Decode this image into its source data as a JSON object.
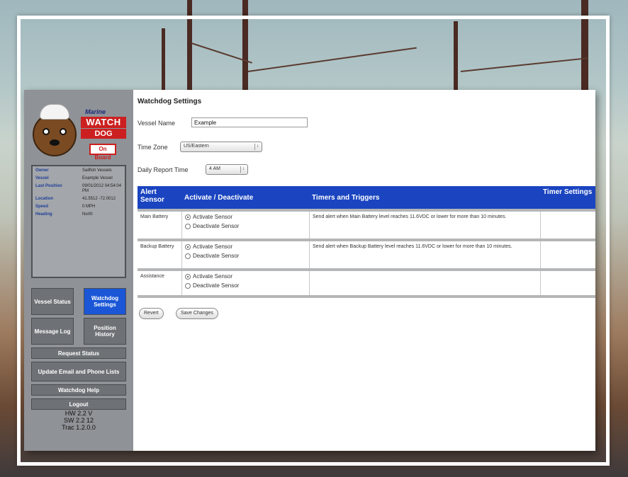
{
  "sidebar": {
    "logo": {
      "top_text": "Marine",
      "watch_text": "WATCH",
      "dog_text": "DOG",
      "onboard_text": "On Board"
    },
    "status": [
      {
        "key": "Owner",
        "value": "Sailfish Vessels"
      },
      {
        "key": "Vessel",
        "value": "Example Vessel"
      },
      {
        "key": "Last Position",
        "value": "09/01/2012 04:54:04 PM"
      },
      {
        "key": "Location",
        "value": "41.5512 -72.0012"
      },
      {
        "key": "Speed",
        "value": "0 MPH"
      },
      {
        "key": "Heading",
        "value": "North"
      }
    ],
    "nav": {
      "vessel_status": "Vessel Status",
      "watchdog_settings": "Watchdog Settings",
      "message_log": "Message Log",
      "position_history": "Position History",
      "request_status": "Request Status",
      "update_email": "Update Email and Phone Lists",
      "watchdog_help": "Watchdog Help",
      "logout": "Logout"
    },
    "versions": {
      "hw": "HW 2.2 V",
      "sw": "SW 2.2 12",
      "tracker": "Trac 1.2.0.0"
    }
  },
  "content": {
    "title": "Watchdog Settings",
    "vessel_name_label": "Vessel Name",
    "vessel_name_value": "Example",
    "time_zone_label": "Time Zone",
    "time_zone_value": "US/Eastern",
    "daily_report_label": "Daily Report Time",
    "daily_report_value": "4 AM",
    "table": {
      "headers": [
        "Alert Sensor",
        "Activate / Deactivate",
        "Timers and Triggers",
        "Timer Settings"
      ],
      "activate_label": "Activate Sensor",
      "deactivate_label": "Deactivate Sensor",
      "rows": [
        {
          "sensor": "Main Battery",
          "trigger": "Send alert when Main Battery level reaches 11.6VDC or lower for more than 10 minutes."
        },
        {
          "sensor": "Backup Battery",
          "trigger": "Send alert when Backup Battery level reaches 11.6VDC or lower for more than 10 minutes."
        },
        {
          "sensor": "Assistance",
          "trigger": ""
        }
      ]
    },
    "buttons": {
      "revert": "Revert",
      "save": "Save Changes"
    }
  },
  "colors": {
    "header_blue": "#1a44c0",
    "active_nav": "#1a56d6",
    "sidebar_gray": "#8f9296",
    "logo_red": "#cc1f1f"
  }
}
